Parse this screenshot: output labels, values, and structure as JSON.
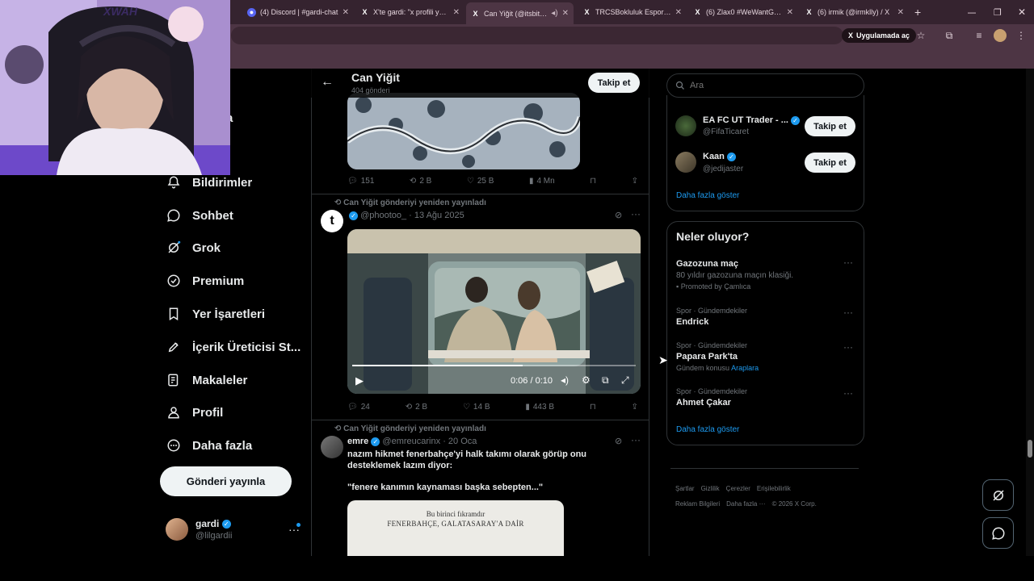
{
  "browser": {
    "tabs": [
      {
        "title": "(4) Discord | #gardi-chat",
        "icon": "D"
      },
      {
        "title": "X'te gardi: \"x profili yorum\"",
        "icon": "X"
      },
      {
        "title": "Can Yiğit (@itsbitter)",
        "icon": "X"
      },
      {
        "title": "TRCSBokluluk Esports (@",
        "icon": "X"
      },
      {
        "title": "(6) Zlax0 #WeWantGTA6",
        "icon": "X"
      },
      {
        "title": "(6) irmik (@irmklly) / X",
        "icon": "X"
      }
    ],
    "open_in_app_label": "Uygulamada aç"
  },
  "webcam": {
    "overlay_text": "XWAH"
  },
  "sidebar": {
    "items": [
      {
        "label": "Bildirimler",
        "icon": "bell-icon"
      },
      {
        "label": "Sohbet",
        "icon": "chat-icon"
      },
      {
        "label": "Grok",
        "icon": "grok-icon"
      },
      {
        "label": "Premium",
        "icon": "premium-icon"
      },
      {
        "label": "Yer İşaretleri",
        "icon": "bookmark-icon"
      },
      {
        "label": "İçerik Üreticisi St...",
        "icon": "rocket-icon"
      },
      {
        "label": "Makaleler",
        "icon": "articles-icon"
      },
      {
        "label": "Profil",
        "icon": "person-icon"
      },
      {
        "label": "Daha fazla",
        "icon": "more-circle-icon"
      }
    ],
    "partial_label": "fa",
    "post_button": "Gönderi yayınla",
    "account": {
      "name": "gardi",
      "handle": "@lilgardii"
    }
  },
  "profile_header": {
    "name": "Can Yiğit",
    "posts": "404 gönderi",
    "follow": "Takip et"
  },
  "tweets": [
    {
      "actions": {
        "replies": "151",
        "reposts": "2 B",
        "likes": "25 B",
        "views": "4 Mn"
      }
    },
    {
      "repost_note": "Can Yiğit gönderiyi yeniden yayınladı",
      "handle": "@phootoo_",
      "date": "13 Ağu 2025",
      "avatar_letter": "t",
      "video_time": "0:06 / 0:10",
      "video_progress": 0.6,
      "actions": {
        "replies": "24",
        "reposts": "2 B",
        "likes": "14 B",
        "views": "443 B"
      }
    },
    {
      "repost_note": "Can Yiğit gönderiyi yeniden yayınladı",
      "name": "emre",
      "handle": "@emreucarinx",
      "date": "20 Oca",
      "text": "nazım hikmet fenerbahçe'yi halk takımı olarak görüp onu desteklemek lazım diyor:",
      "quote": "\"fenere kanımın kaynaması başka sebepten...\"",
      "book_line1": "Bu birinci fıkramdır",
      "book_line2": "FENERBAHÇE, GALATASARAY'A DAİR"
    }
  ],
  "search": {
    "placeholder": "Ara"
  },
  "who_to_follow": {
    "users": [
      {
        "name": "EA FC UT Trader - ...",
        "handle": "@FifaTicaret",
        "button": "Takip et"
      },
      {
        "name": "Kaan",
        "handle": "@jedijaster",
        "button": "Takip et"
      }
    ],
    "show_more": "Daha fazla göster"
  },
  "trends": {
    "title": "Neler oluyor?",
    "items": [
      {
        "meta": "",
        "name": "Gazozuna maç",
        "sub": "80 yıldır gazozuna maçın klasiği.",
        "promoted": "Promoted by Çamlıca"
      },
      {
        "meta": "Spor · Gündemdekiler",
        "name": "Endrick"
      },
      {
        "meta": "Spor · Gündemdekiler",
        "name": "Papara Park'ta",
        "topic_prefix": "Gündem konusu",
        "topic_link": "Araplara"
      },
      {
        "meta": "Spor · Gündemdekiler",
        "name": "Ahmet Çakar"
      }
    ],
    "show_more": "Daha fazla göster"
  },
  "footer": {
    "links": [
      "Şartlar",
      "Gizlilik",
      "Çerezler",
      "Erişilebilirlik",
      "Reklam Bilgileri",
      "Daha fazla ···",
      "© 2026 X Corp."
    ]
  }
}
